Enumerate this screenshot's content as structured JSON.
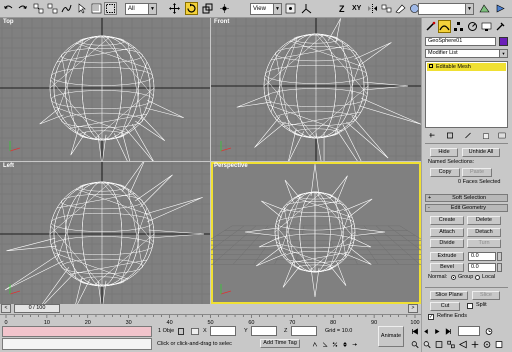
{
  "toolbar": {
    "selection_filter": "All",
    "reference_coord": "View",
    "axis_z": "Z",
    "axis_xy": "XY"
  },
  "viewports": {
    "top": "Top",
    "front": "Front",
    "left": "Left",
    "perspective": "Perspective"
  },
  "command_panel": {
    "object_name": "GeoSphere01",
    "modifier_list": "Modifier List",
    "stack_item": "Editable Mesh",
    "hide": "Hide",
    "unhide_all": "Unhide All",
    "named_selections": "Named Selections:",
    "copy": "Copy",
    "paste": "Paste",
    "faces_selected": "0 Faces Selected",
    "soft_selection": "Soft Selection",
    "edit_geometry": "Edit Geometry",
    "create": "Create",
    "delete": "Delete",
    "attach": "Attach",
    "detach": "Detach",
    "divide": "Divide",
    "turn": "Turn",
    "extrude": "Extrude",
    "extrude_value": "0.0",
    "bevel": "Bevel",
    "bevel_value": "0.0",
    "normal": "Normal:",
    "group": "Group",
    "local": "Local",
    "slice_plane": "Slice Plane",
    "slice": "Slice",
    "cut": "Cut",
    "split": "Split",
    "refine_ends": "Refine Ends"
  },
  "timeline": {
    "frame_counter": "0 / 100",
    "ticks": [
      "0",
      "10",
      "20",
      "30",
      "40",
      "50",
      "60",
      "70",
      "80",
      "90",
      "100"
    ]
  },
  "status": {
    "selection": "1 Obje",
    "x_label": "X",
    "y_label": "Y",
    "z_label": "Z",
    "grid": "Grid = 10.0",
    "animate": "Animate",
    "prompt": "Click or click-and-drag to selec",
    "add_time_tag": "Add Time Tag"
  }
}
